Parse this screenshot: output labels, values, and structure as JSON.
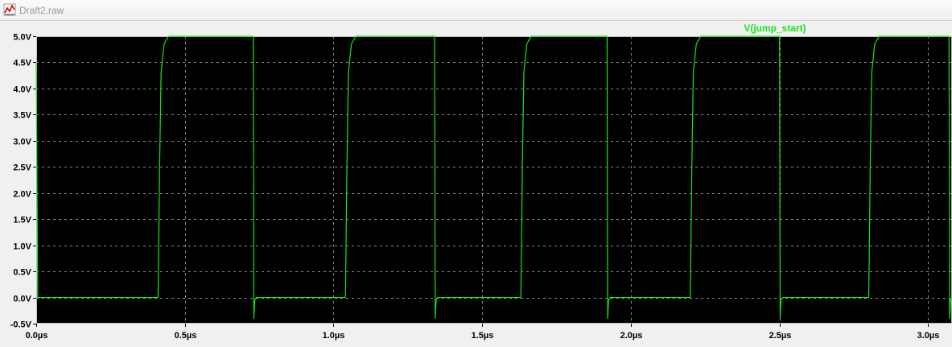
{
  "window": {
    "title": "Draft2.raw",
    "icon": "waveform-chart-icon"
  },
  "colors": {
    "plot_background": "#000000",
    "trace": "#19e619",
    "grid": "#8a8a8a",
    "axis_frame": "#bfbfbf",
    "label": "#000000"
  },
  "chart_data": {
    "type": "line",
    "title": "",
    "xlabel": "",
    "ylabel": "",
    "xlim": [
      0,
      3.08
    ],
    "ylim": [
      -0.5,
      5.0
    ],
    "grid": true,
    "legend": "top-right",
    "x_ticks": [
      {
        "value": 0.0,
        "label": "0.0µs"
      },
      {
        "value": 0.5,
        "label": "0.5µs"
      },
      {
        "value": 1.0,
        "label": "1.0µs"
      },
      {
        "value": 1.5,
        "label": "1.5µs"
      },
      {
        "value": 2.0,
        "label": "2.0µs"
      },
      {
        "value": 2.5,
        "label": "2.5µs"
      },
      {
        "value": 3.0,
        "label": "3.0µs"
      }
    ],
    "y_ticks": [
      {
        "value": 5.0,
        "label": "5.0V"
      },
      {
        "value": 4.5,
        "label": "4.5V"
      },
      {
        "value": 4.0,
        "label": "4.0V"
      },
      {
        "value": 3.5,
        "label": "3.5V"
      },
      {
        "value": 3.0,
        "label": "3.0V"
      },
      {
        "value": 2.5,
        "label": "2.5V"
      },
      {
        "value": 2.0,
        "label": "2.0V"
      },
      {
        "value": 1.5,
        "label": "1.5V"
      },
      {
        "value": 1.0,
        "label": "1.0V"
      },
      {
        "value": 0.5,
        "label": "0.5V"
      },
      {
        "value": 0.0,
        "label": "0.0V"
      },
      {
        "value": -0.5,
        "label": "-0.5V"
      }
    ],
    "series": [
      {
        "name": "V(jump_start)",
        "color": "#19e619",
        "x": [
          0.0,
          0.005,
          0.008,
          0.41,
          0.415,
          0.42,
          0.43,
          0.445,
          0.73,
          0.732,
          0.735,
          0.74,
          1.04,
          1.045,
          1.05,
          1.06,
          1.075,
          1.34,
          1.342,
          1.345,
          1.35,
          1.63,
          1.635,
          1.64,
          1.65,
          1.665,
          1.92,
          1.922,
          1.925,
          1.93,
          2.2,
          2.205,
          2.21,
          2.22,
          2.235,
          2.5,
          2.502,
          2.505,
          2.51,
          2.8,
          2.805,
          2.81,
          2.82,
          2.835,
          3.07,
          3.072,
          3.075,
          3.08
        ],
        "y": [
          4.5,
          0.0,
          0.0,
          0.0,
          2.5,
          4.3,
          4.85,
          5.0,
          5.0,
          -0.4,
          -0.05,
          0.0,
          0.0,
          2.5,
          4.3,
          4.85,
          5.0,
          5.0,
          -0.4,
          -0.05,
          0.0,
          0.0,
          2.5,
          4.3,
          4.85,
          5.0,
          5.0,
          -0.4,
          -0.05,
          0.0,
          0.0,
          2.5,
          4.3,
          4.85,
          5.0,
          5.0,
          -0.4,
          -0.05,
          0.0,
          0.0,
          2.5,
          4.3,
          4.85,
          5.0,
          5.0,
          -0.4,
          -0.05,
          0.0
        ]
      }
    ]
  }
}
